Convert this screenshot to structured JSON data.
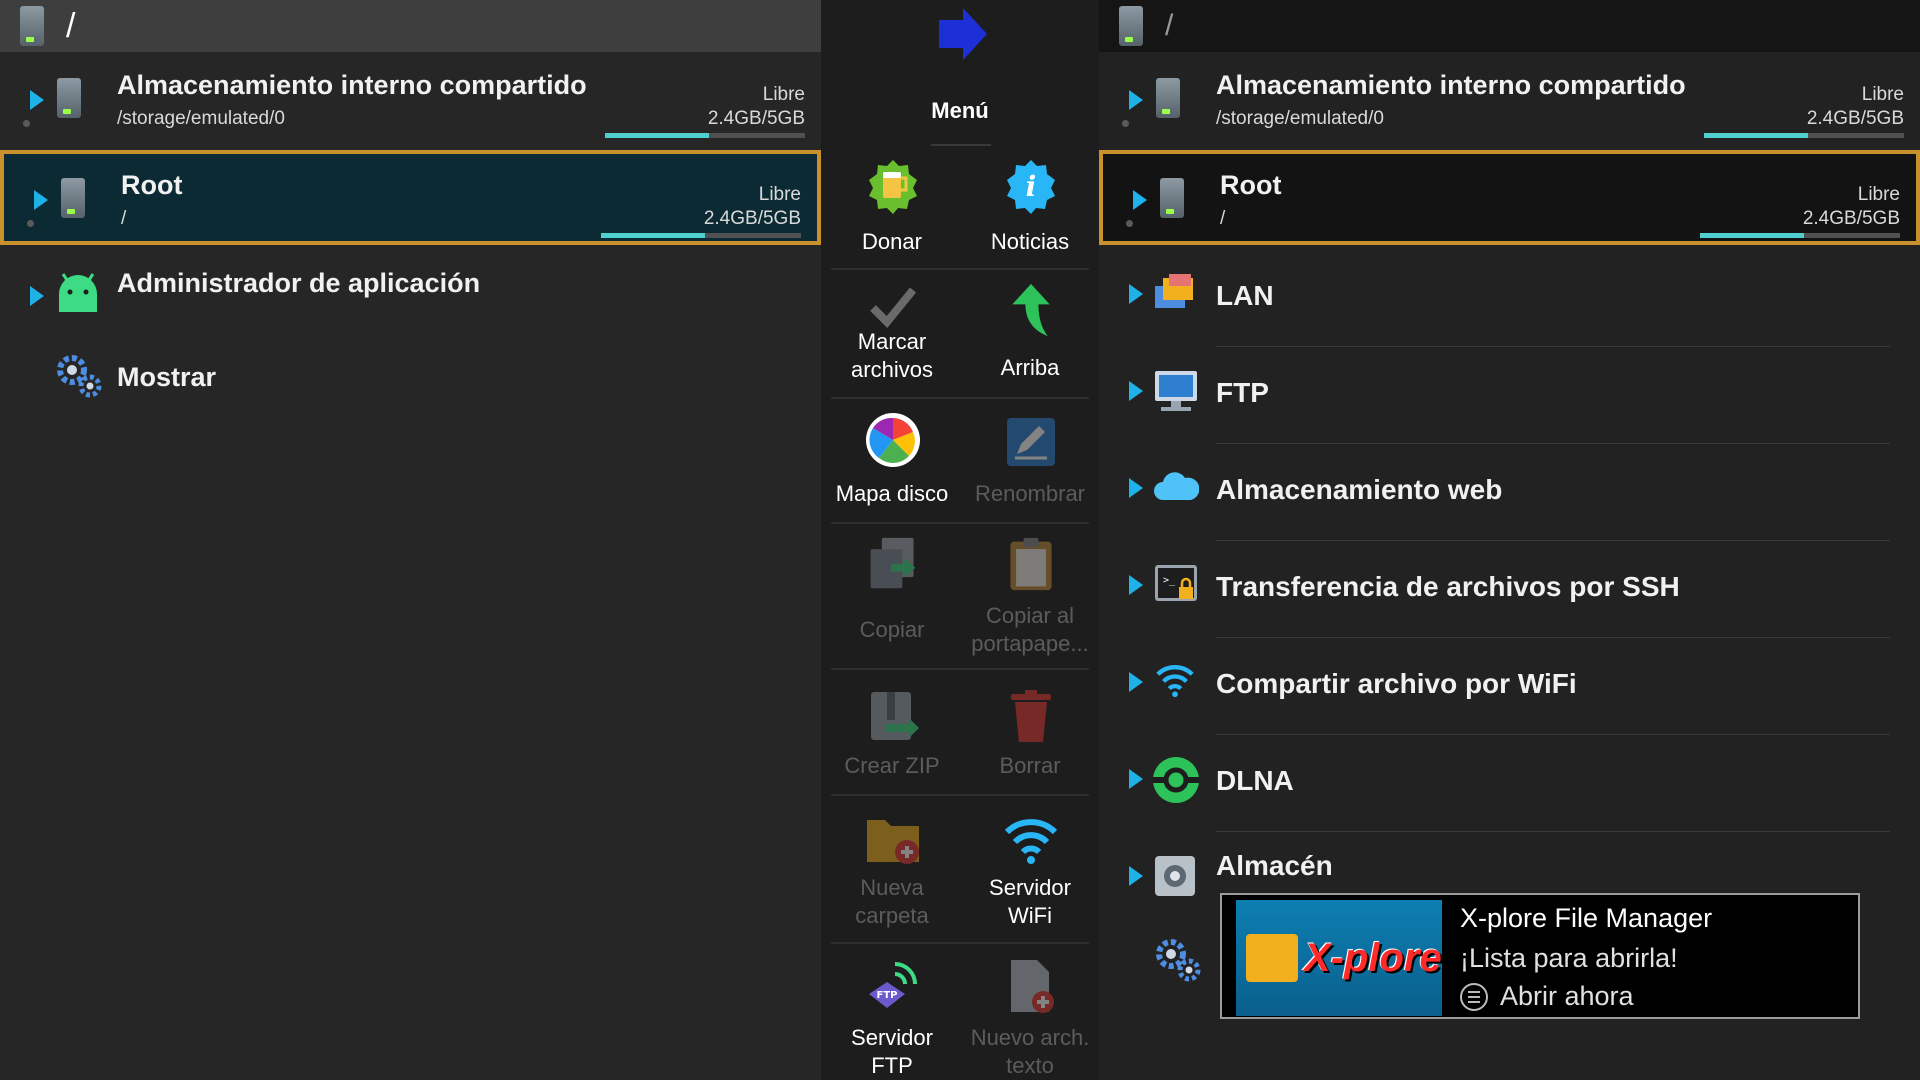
{
  "left_pane": {
    "path": "/",
    "rows": [
      {
        "title": "Almacenamiento interno compartido",
        "subtitle": "/storage/emulated/0",
        "free_label": "Libre",
        "free_value": "2.4GB/5GB",
        "used_fraction": 0.52
      },
      {
        "title": "Root",
        "subtitle": "/",
        "free_label": "Libre",
        "free_value": "2.4GB/5GB",
        "used_fraction": 0.52
      },
      {
        "title": "Administrador de aplicación"
      },
      {
        "title": "Mostrar"
      }
    ]
  },
  "menu": {
    "title": "Menú",
    "items": [
      {
        "label_1": "Donar",
        "enabled": true,
        "icon": "beer-mug-icon"
      },
      {
        "label_1": "Noticias",
        "enabled": true,
        "icon": "info-icon"
      },
      {
        "label_1": "Marcar",
        "label_2": "archivos",
        "enabled": true,
        "icon": "checkmark-icon"
      },
      {
        "label_1": "Arriba",
        "enabled": true,
        "icon": "arrow-up-icon"
      },
      {
        "label_1": "Mapa disco",
        "enabled": true,
        "icon": "disk-map-icon"
      },
      {
        "label_1": "Renombrar",
        "enabled": false,
        "icon": "rename-icon"
      },
      {
        "label_1": "Copiar",
        "enabled": false,
        "icon": "copy-icon"
      },
      {
        "label_1": "Copiar al",
        "label_2": "portapape...",
        "enabled": false,
        "icon": "clipboard-icon"
      },
      {
        "label_1": "Crear ZIP",
        "enabled": false,
        "icon": "zip-icon"
      },
      {
        "label_1": "Borrar",
        "enabled": false,
        "icon": "trash-icon"
      },
      {
        "label_1": "Nueva",
        "label_2": "carpeta",
        "enabled": false,
        "icon": "new-folder-icon"
      },
      {
        "label_1": "Servidor",
        "label_2": "WiFi",
        "enabled": true,
        "icon": "wifi-icon"
      },
      {
        "label_1": "Servidor",
        "label_2": "FTP",
        "enabled": true,
        "icon": "ftp-server-icon"
      },
      {
        "label_1": "Nuevo arch.",
        "label_2": "texto",
        "enabled": false,
        "icon": "new-text-file-icon"
      }
    ]
  },
  "right_pane": {
    "path": "/",
    "rows": [
      {
        "title": "Almacenamiento interno compartido",
        "subtitle": "/storage/emulated/0",
        "free_label": "Libre",
        "free_value": "2.4GB/5GB",
        "used_fraction": 0.52
      },
      {
        "title": "Root",
        "subtitle": "/",
        "free_label": "Libre",
        "free_value": "2.4GB/5GB",
        "used_fraction": 0.52
      },
      {
        "title": "LAN"
      },
      {
        "title": "FTP"
      },
      {
        "title": "Almacenamiento web"
      },
      {
        "title": "Transferencia de archivos por SSH"
      },
      {
        "title": "Compartir archivo por WiFi"
      },
      {
        "title": "DLNA"
      },
      {
        "title": "Almacén"
      }
    ]
  },
  "notification": {
    "app_name": "X-plore File Manager",
    "message": "¡Lista para abrirla!",
    "action": "Abrir ahora",
    "logo_text": "X-plore"
  },
  "colors": {
    "accent_blue": "#1fb2e8",
    "selection_border": "#c8912d",
    "bar_fill": "#4fd0cf"
  }
}
